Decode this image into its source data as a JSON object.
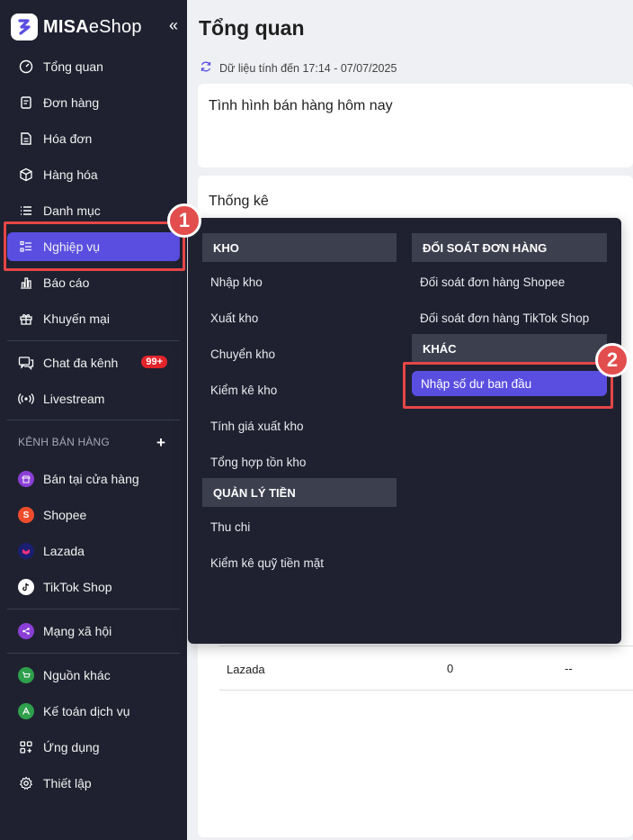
{
  "app": {
    "logo_bold": "MISA",
    "logo_light": "eShop",
    "collapse_icon": "«"
  },
  "sidebar": {
    "items": [
      {
        "label": "Tổng quan"
      },
      {
        "label": "Đơn hàng"
      },
      {
        "label": "Hóa đơn"
      },
      {
        "label": "Hàng hóa"
      },
      {
        "label": "Danh mục"
      },
      {
        "label": "Nghiệp vụ"
      },
      {
        "label": "Báo cáo"
      },
      {
        "label": "Khuyến mại"
      }
    ],
    "chat": {
      "label": "Chat đa kênh",
      "badge": "99+"
    },
    "livestream": {
      "label": "Livestream"
    },
    "channels_title": "KÊNH BÁN HÀNG",
    "channels_add": "+",
    "channels": [
      {
        "label": "Bán tại cửa hàng",
        "color": "#8b3fd6"
      },
      {
        "label": "Shopee",
        "color": "#ee4d2d"
      },
      {
        "label": "Lazada",
        "color": "#1a1f71"
      },
      {
        "label": "TikTok Shop",
        "color": "#ffffff"
      }
    ],
    "social": {
      "label": "Mạng xã hội",
      "color": "#8b3fd6"
    },
    "bottom": [
      {
        "label": "Nguồn khác",
        "color": "#2e9f4b"
      },
      {
        "label": "Kế toán dịch vụ",
        "color": "#2e9f4b"
      },
      {
        "label": "Ứng dụng"
      },
      {
        "label": "Thiết lập"
      }
    ]
  },
  "main": {
    "title": "Tổng quan",
    "data_time": "Dữ liệu tính đến 17:14 - 07/07/2025",
    "card1_title": "Tình hình bán hàng hôm nay",
    "card2_title": "Thống kê",
    "table_row": {
      "name": "Lazada",
      "value": "0",
      "other": "--"
    }
  },
  "dropdown": {
    "kho": {
      "title": "KHO",
      "items": [
        "Nhập kho",
        "Xuất kho",
        "Chuyển kho",
        "Kiểm kê kho",
        "Tính giá xuất kho",
        "Tổng hợp tồn kho"
      ]
    },
    "tien": {
      "title": "QUẢN LÝ TIỀN",
      "items": [
        "Thu chi",
        "Kiểm kê quỹ tiền mặt"
      ]
    },
    "doisoat": {
      "title": "ĐỐI SOÁT ĐƠN HÀNG",
      "items": [
        "Đối soát đơn hàng Shopee",
        "Đối soát đơn hàng TikTok Shop"
      ]
    },
    "khac": {
      "title": "KHÁC",
      "items": [
        "Nhập số dư ban đầu"
      ]
    }
  },
  "annotations": {
    "step1": "1",
    "step2": "2",
    "color": "#e24d4d"
  }
}
